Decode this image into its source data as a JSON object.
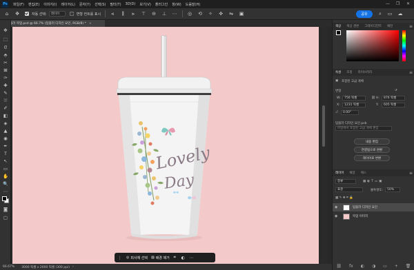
{
  "app": {
    "logo": "Ps"
  },
  "menu": [
    "파일(F)",
    "편집(E)",
    "이미지(I)",
    "레이어(L)",
    "문자(Y)",
    "선택(S)",
    "필터(T)",
    "3D(D)",
    "보기(V)",
    "플러그인",
    "창(W)",
    "도움말(H)"
  ],
  "window_controls": [
    "—",
    "❐",
    "✕"
  ],
  "options_bar": {
    "auto_select_label": "자동 선택:",
    "auto_select_value": "레이어",
    "transform_label": "변형 컨트롤 표시",
    "share_label": "공유"
  },
  "document_tab": {
    "title": "텀블러 목업.psd @ 66.7% (텀블러 디자인 요인, RGB/8) *",
    "close": "×"
  },
  "tools": [
    "✥",
    "⬚",
    "ᘓ",
    "⬘",
    "✂",
    "⊠",
    "✑",
    "✚",
    "✎",
    "⛆",
    "✐",
    "◧",
    "◈",
    "▲",
    "◉",
    "✒",
    "T",
    "↖",
    "▭",
    "✋",
    "🔍",
    "⋯"
  ],
  "canvas": {
    "background": "#f3c9c9",
    "artwork_text_line1": "Lovely",
    "artwork_text_line2": "Day"
  },
  "taskbar": {
    "select_subject": "피사체 선택",
    "remove_background": "배경 제거",
    "more_icon": "⋯"
  },
  "status": {
    "zoom": "66.67%",
    "doc_info": "3000 픽셀 x 2000 픽셀 (300 ppi)"
  },
  "panels": {
    "color_tabs": [
      "색상",
      "색상 견본",
      "그레이디언트",
      "패턴"
    ],
    "props_tabs": [
      "속성",
      "조정",
      "라이브러리"
    ],
    "props_title": "포함된 고급 개체",
    "transform_label": "변형",
    "w_label": "W:",
    "w_value": "756 픽셀",
    "h_label": "H:",
    "h_value": "876 픽셀",
    "x_label": "X:",
    "x_value": "1231 픽셀",
    "y_label": "Y:",
    "y_value": "605 픽셀",
    "angle_value": "0.00°",
    "embedded_label": "텀블러 디자인 요인.psb",
    "embedded_hint": "파일에서 포함된 고급 개체 편집",
    "btn_edit": "내용 편집",
    "btn_convert": "연결됨으로 변환",
    "btn_layers": "레이어로 변환",
    "layers_tabs": [
      "레이어",
      "채널",
      "패스"
    ],
    "layers_search": "종류",
    "blend_mode": "표준",
    "opacity_label": "불투명도:",
    "opacity_value": "50%",
    "layers": [
      {
        "name": "텀블러 디자인 요인",
        "thumb_color": "#ffffff"
      },
      {
        "name": "목업 이미지",
        "thumb_color": "#f3c9c9"
      }
    ],
    "layer_bottom_icons": [
      "⛓",
      "fx",
      "◐",
      "◑",
      "▭",
      "+",
      "🗑"
    ]
  },
  "colors": {
    "accent": "#1473e6",
    "canvas_bg": "#f3c9c9",
    "script_text": "#8a7a86"
  }
}
